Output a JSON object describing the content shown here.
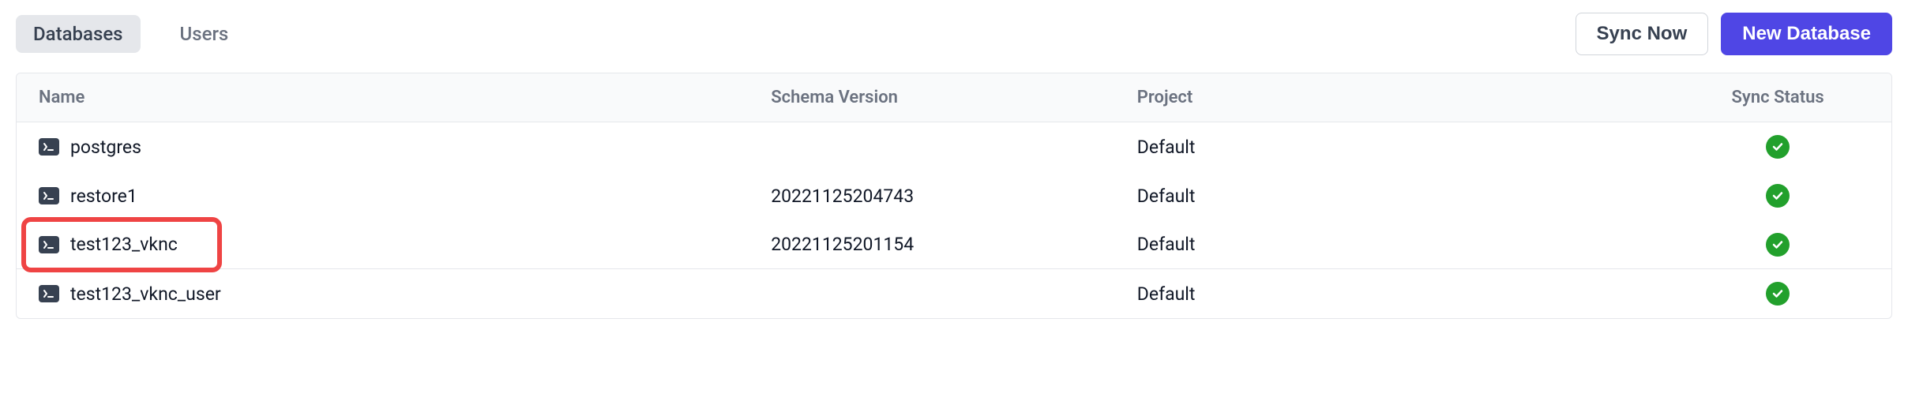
{
  "tabs": {
    "databases": "Databases",
    "users": "Users"
  },
  "buttons": {
    "sync": "Sync Now",
    "new": "New Database"
  },
  "columns": {
    "name": "Name",
    "schema": "Schema Version",
    "project": "Project",
    "sync": "Sync Status"
  },
  "rows": [
    {
      "name": "postgres",
      "schema": "",
      "project": "Default",
      "synced": true,
      "highlight": false
    },
    {
      "name": "restore1",
      "schema": "20221125204743",
      "project": "Default",
      "synced": true,
      "highlight": false
    },
    {
      "name": "test123_vknc",
      "schema": "20221125201154",
      "project": "Default",
      "synced": true,
      "highlight": true
    },
    {
      "name": "test123_vknc_user",
      "schema": "",
      "project": "Default",
      "synced": true,
      "highlight": false
    }
  ]
}
